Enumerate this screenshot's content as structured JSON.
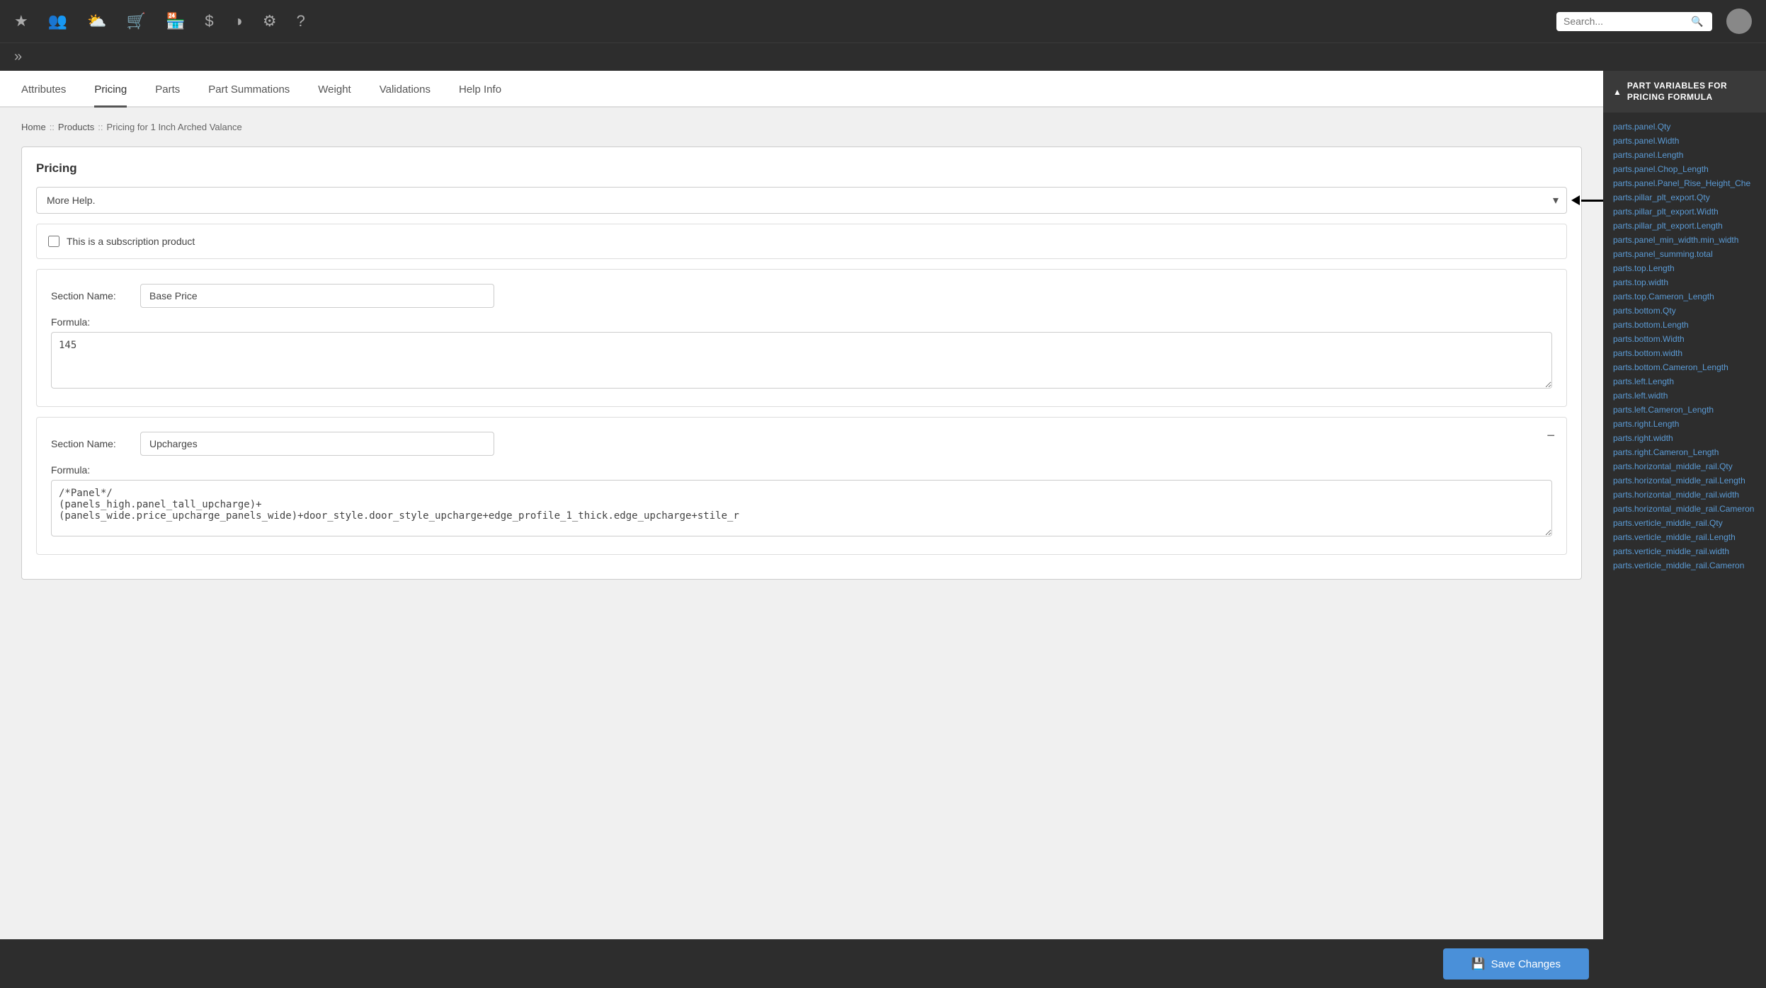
{
  "topnav": {
    "icons": [
      "star",
      "users",
      "layers",
      "cart",
      "store",
      "dollar",
      "chart-pie",
      "gear",
      "question"
    ],
    "search_placeholder": "Search..."
  },
  "tabs": {
    "items": [
      {
        "label": "Attributes",
        "active": false
      },
      {
        "label": "Pricing",
        "active": true
      },
      {
        "label": "Parts",
        "active": false
      },
      {
        "label": "Part Summations",
        "active": false
      },
      {
        "label": "Weight",
        "active": false
      },
      {
        "label": "Validations",
        "active": false
      },
      {
        "label": "Help Info",
        "active": false
      }
    ]
  },
  "breadcrumb": {
    "home": "Home",
    "sep1": "::",
    "products": "Products",
    "sep2": "::",
    "current": "Pricing for 1 Inch Arched Valance"
  },
  "pricing": {
    "title": "Pricing",
    "dropdown_value": "More Help.",
    "subscription_label": "This is a subscription product",
    "sections": [
      {
        "name_label": "Section Name:",
        "name_value": "Base Price",
        "formula_label": "Formula:",
        "formula_value": "145",
        "removable": false
      },
      {
        "name_label": "Section Name:",
        "name_value": "Upcharges",
        "formula_label": "Formula:",
        "formula_value": "/*Panel*/\n(panels_high.panel_tall_upcharge)+\n(panels_wide.price_upcharge_panels_wide)+door_style.door_style_upcharge+edge_profile_1_thick.edge_upcharge+stile_r",
        "removable": true
      }
    ]
  },
  "sidebar": {
    "header": "PART VARIABLES FOR PRICING FORMULA",
    "vars": [
      "parts.panel.Qty",
      "parts.panel.Width",
      "parts.panel.Length",
      "parts.panel.Chop_Length",
      "parts.panel.Panel_Rise_Height_Che",
      "parts.pillar_plt_export.Qty",
      "parts.pillar_plt_export.Width",
      "parts.pillar_plt_export.Length",
      "parts.panel_min_width.min_width",
      "parts.panel_summing.total",
      "parts.top.Length",
      "parts.top.width",
      "parts.top.Cameron_Length",
      "parts.bottom.Qty",
      "parts.bottom.Length",
      "parts.bottom.Width",
      "parts.bottom.width",
      "parts.bottom.Cameron_Length",
      "parts.left.Length",
      "parts.left.width",
      "parts.left.Cameron_Length",
      "parts.right.Length",
      "parts.right.width",
      "parts.right.Cameron_Length",
      "parts.horizontal_middle_rail.Qty",
      "parts.horizontal_middle_rail.Length",
      "parts.horizontal_middle_rail.width",
      "parts.horizontal_middle_rail.Cameron",
      "parts.verticle_middle_rail.Qty",
      "parts.verticle_middle_rail.Length",
      "parts.verticle_middle_rail.width",
      "parts.verticle_middle_rail.Cameron"
    ]
  },
  "save_button": {
    "label": "Save Changes"
  }
}
